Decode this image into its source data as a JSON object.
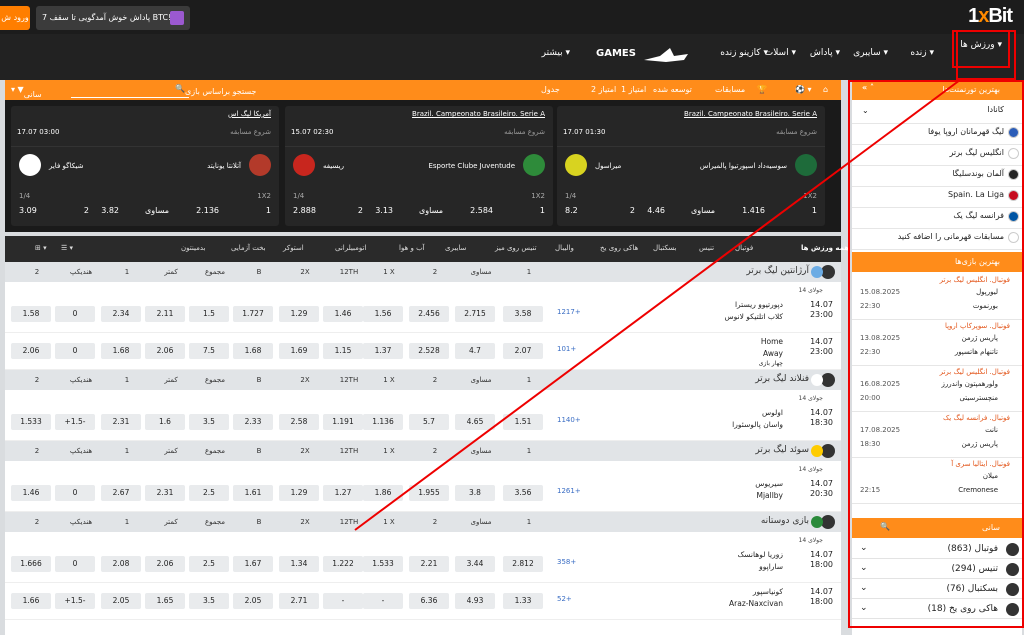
{
  "header": {
    "login": "ورود ش",
    "bonus": "پاداش خوش آمدگویی تا سقف 7 BTC!",
    "logo_a": "1",
    "logo_b": "x",
    "logo_c": "Bit"
  },
  "nav": {
    "items": [
      "ورزش ها",
      "زنده",
      "سایبری",
      "پاداش",
      "اسلات",
      "کازینو زنده",
      "GAMES",
      "بیشتر"
    ]
  },
  "bar": {
    "search": "جستجو براساس بازی",
    "filter": "سانی",
    "tabs": [
      "مسابقات",
      "توسعه شده",
      "1 امتیاز",
      "2 امتیاز",
      "جدول"
    ]
  },
  "cards": [
    {
      "title": "Brazil. Campeonato Brasileiro. Serie A",
      "start": "شروع مسابقه",
      "time": "17.07 01:30",
      "team1": "سوسیه‌داد اسپورتیوا پالمیراس",
      "team2": "میراسول",
      "k1": "1.416",
      "kx": "4.46",
      "k2": "8.2"
    },
    {
      "title": "Brazil. Campeonato Brasileiro. Serie A",
      "start": "شروع مسابقه",
      "time": "15.07 02:30",
      "team1": "Esporte Clube Juventude",
      "team2": "ریسیفه",
      "k1": "2.584",
      "kx": "3.13",
      "k2": "2.888"
    },
    {
      "title": "آمریکا لیگ اس",
      "start": "شروع مسابقه",
      "time": "17.07 03:00",
      "team1": "آتلانتا یونایتد",
      "team2": "شیکاگو فایر",
      "k1": "2.136",
      "kx": "3.82",
      "k2": "3.09"
    }
  ],
  "card_labels": {
    "ratio": "1/4",
    "type": "1X2",
    "draw": "مساوی"
  },
  "tabs": [
    "همه ورزش ها",
    "فوتبال",
    "تنیس",
    "بسکتبال",
    "هاکی روی یخ",
    "والیبال",
    "تنیس روی میز",
    "سایبری",
    "آب و هوا",
    "اتومبیلرانی",
    "استوکر",
    "بخت آزمایی",
    "بدمینتون"
  ],
  "columns": [
    "1",
    "مساوی",
    "2",
    "1 X",
    "12TH",
    "2X",
    "B",
    "مجموع",
    "کمتر",
    "1",
    "هندیکپ",
    "2"
  ],
  "leagues": [
    {
      "name": "آرژانتین لیگ برتر",
      "round": "14 جولای",
      "rows": [
        {
          "t1": "دپورتیوو ریسترا",
          "t2": "کلاب اتلتیکو لانوس",
          "date": "14.07",
          "time": "23:00",
          "more": "1217+",
          "odds": [
            "3.58",
            "2.715",
            "2.456",
            "1.56",
            "1.46",
            "1.29",
            "1.727",
            "1.5",
            "2.11",
            "2.34",
            "0",
            "1.58"
          ]
        },
        {
          "t1": "Home",
          "t2": "Away",
          "t3": "چهار بازی",
          "date": "14.07",
          "time": "23:00",
          "more": "101+",
          "odds": [
            "2.07",
            "4.7",
            "2.528",
            "1.37",
            "1.15",
            "1.69",
            "1.68",
            "7.5",
            "2.06",
            "1.68",
            "0",
            "2.06"
          ]
        }
      ]
    },
    {
      "name": "فنلاند لیگ برتر",
      "round": "14 جولای",
      "rows": [
        {
          "t1": "اولوس",
          "t2": "واسان پالوسئورا",
          "date": "14.07",
          "time": "18:30",
          "more": "1140+",
          "odds": [
            "1.51",
            "4.65",
            "5.7",
            "1.136",
            "1.191",
            "2.58",
            "2.33",
            "3.5",
            "1.6",
            "2.31",
            "+1.5-",
            "1.533"
          ]
        }
      ]
    },
    {
      "name": "سوئد لیگ برتر",
      "round": "14 جولای",
      "rows": [
        {
          "t1": "سیریوس",
          "t2": "Mjallby",
          "date": "14.07",
          "time": "20:30",
          "more": "1261+",
          "odds": [
            "3.56",
            "3.8",
            "1.955",
            "1.86",
            "1.27",
            "1.29",
            "1.61",
            "2.5",
            "2.31",
            "2.67",
            "0",
            "1.46"
          ]
        }
      ]
    },
    {
      "name": "بازی دوستانه",
      "round": "14 جولای",
      "rows": [
        {
          "t1": "زوریا لوهانسک",
          "t2": "ساراپوو",
          "date": "14.07",
          "time": "18:00",
          "more": "358+",
          "odds": [
            "2.812",
            "3.44",
            "2.21",
            "1.533",
            "1.222",
            "1.34",
            "1.67",
            "2.5",
            "2.06",
            "2.08",
            "0",
            "1.666"
          ]
        },
        {
          "t1": "کونیاسپور",
          "t2": "Araz-Naxcivan",
          "date": "14.07",
          "time": "18:00",
          "more": "52+",
          "odds": [
            "1.33",
            "4.93",
            "6.36",
            "-",
            "-",
            "2.71",
            "2.05",
            "3.5",
            "1.65",
            "2.05",
            "+1.5-",
            "1.66"
          ]
        }
      ]
    }
  ],
  "sidebar": {
    "top_title": "بهترین تورنمنت‌ها",
    "country": "کانادا",
    "tournaments": [
      "لیگ قهرمانان اروپا یوفا",
      "انگلیس لیگ برتر",
      "آلمان بوندسلیگا",
      "Spain. La Liga",
      "فرانسه لیگ یک",
      "مسابقات قهرمانی را اضافه کنید"
    ],
    "games_title": "بهترین بازی‌ها",
    "games": [
      {
        "league": "فوتبال. انگلیس لیگ برتر",
        "a": "لیورپول",
        "b": "بورنموت",
        "date": "15.08.2025",
        "time": "22:30"
      },
      {
        "league": "فوتبال. سوپرکاپ اروپا",
        "a": "پاریس ژرمن",
        "b": "تاتنهام هاتسپور",
        "date": "13.08.2025",
        "time": "22:30"
      },
      {
        "league": "فوتبال. انگلیس لیگ برتر",
        "a": "ولورهمپتون واندررز",
        "b": "منچسترسیتی",
        "date": "16.08.2025",
        "time": "20:00"
      },
      {
        "league": "فوتبال. فرانسه لیگ یک",
        "a": "نانت",
        "b": "پاریس ژرمن",
        "date": "17.08.2025",
        "time": "18:30"
      },
      {
        "league": "فوتبال. ایتالیا سری آ",
        "a": "میلان",
        "b": "Cremonese",
        "date": "",
        "time": "22:15"
      }
    ],
    "filter": "سانی",
    "sports": [
      "فوتبال (863)",
      "تنیس (294)",
      "بسکتبال (76)",
      "هاکی روی یخ (18)"
    ]
  }
}
